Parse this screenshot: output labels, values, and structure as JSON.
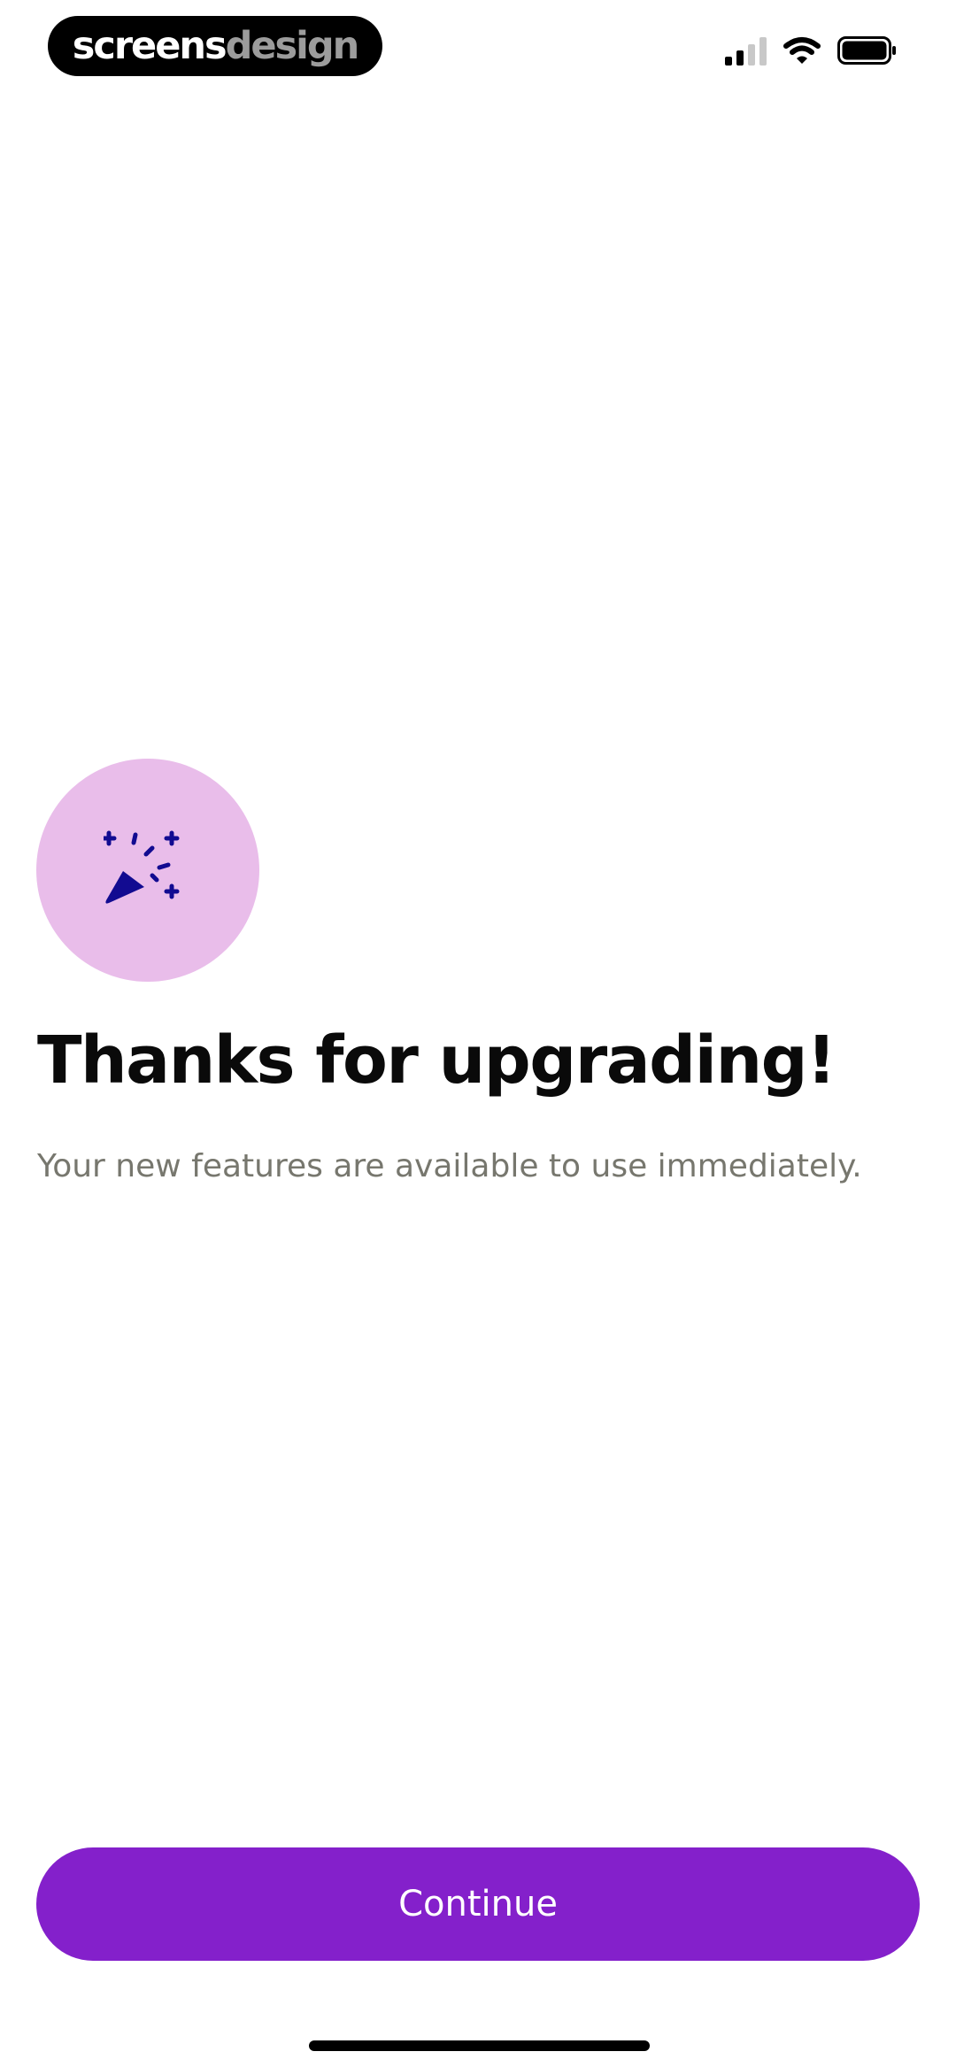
{
  "watermark": {
    "part1": "screens",
    "part2": "design"
  },
  "status_bar": {
    "signal_icon": "cellular-signal-icon",
    "wifi_icon": "wifi-icon",
    "battery_icon": "battery-icon"
  },
  "badge": {
    "icon": "party-popper-icon",
    "circle_color": "#e9bdea",
    "icon_color": "#120b91"
  },
  "content": {
    "title": "Thanks for upgrading!",
    "subtitle": "Your new features are available to use immediately."
  },
  "actions": {
    "continue_label": "Continue",
    "accent_color": "#8420cb"
  }
}
